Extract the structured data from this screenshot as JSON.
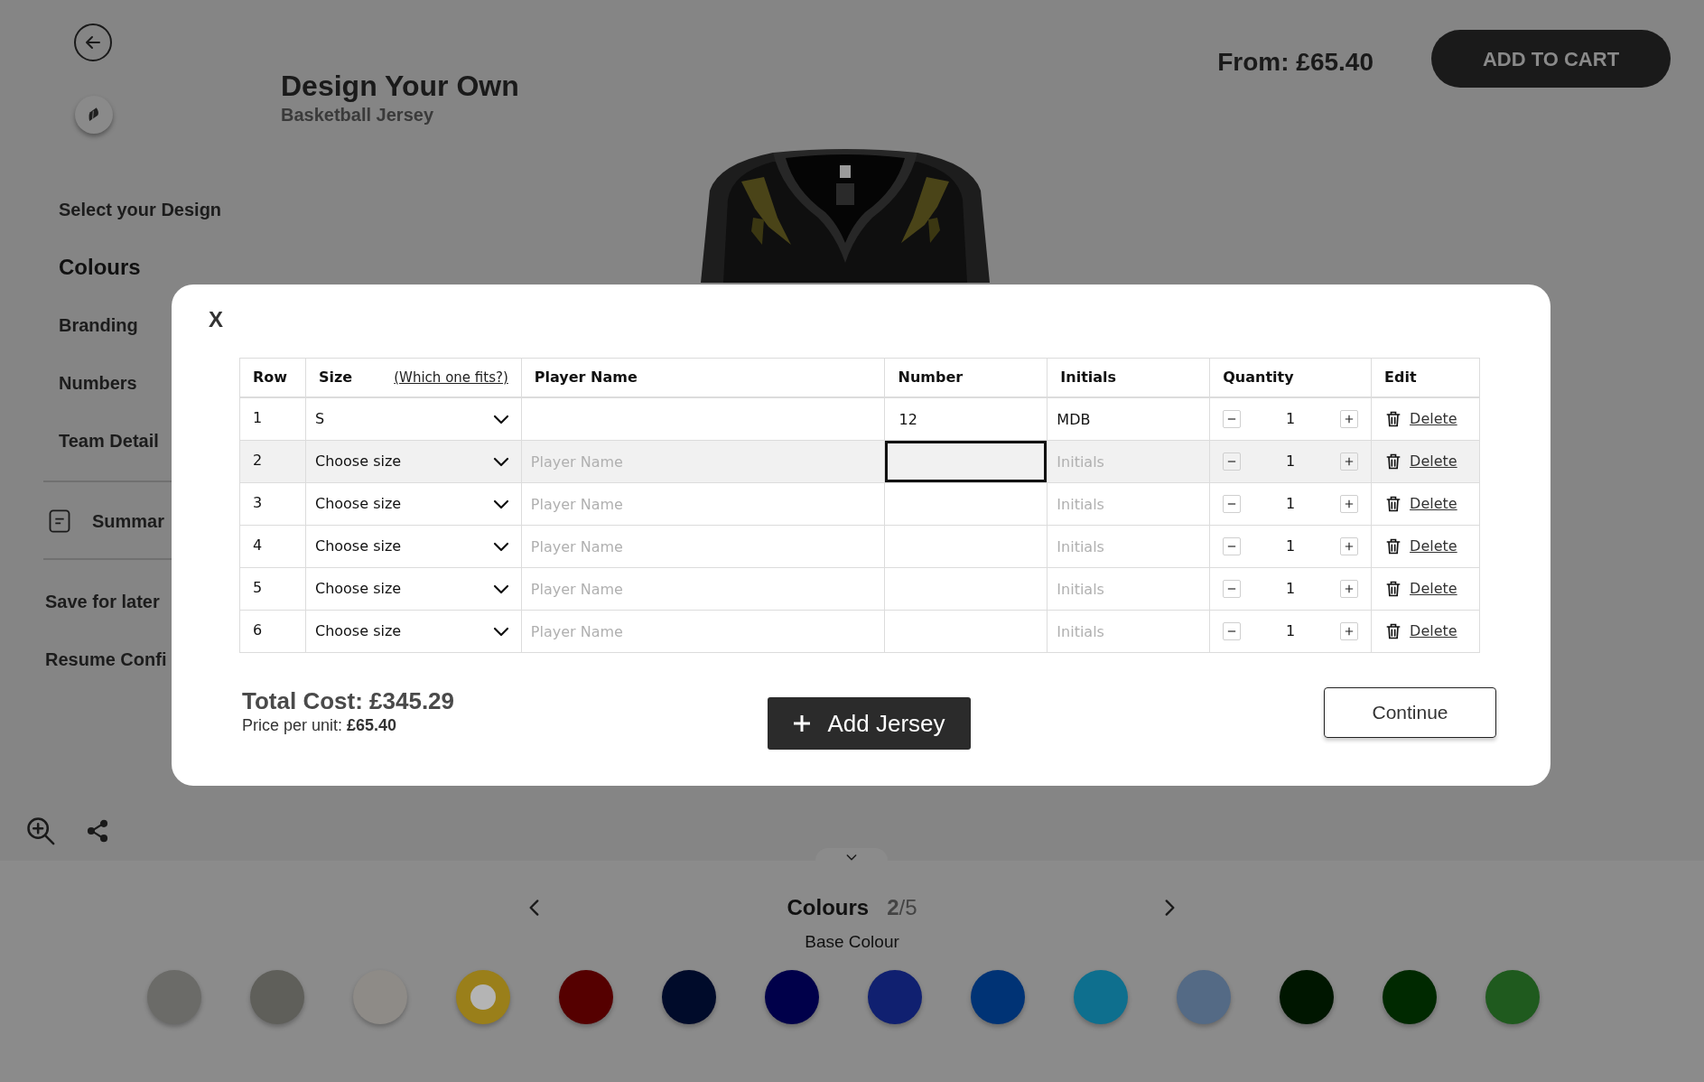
{
  "header": {
    "title": "Design Your Own",
    "subtitle": "Basketball Jersey",
    "price": "From: £65.40",
    "add_to_cart": "ADD TO CART"
  },
  "sidebar": {
    "items": [
      {
        "label": "Select your Design",
        "selected": false
      },
      {
        "label": "Colours",
        "selected": true
      },
      {
        "label": "Branding",
        "selected": false
      },
      {
        "label": "Numbers",
        "selected": false
      },
      {
        "label": "Team Detail",
        "selected": false
      }
    ],
    "summary": "Summar",
    "actions": [
      "Save for later",
      "Resume Confi"
    ]
  },
  "modal": {
    "close": "X",
    "size_help": "(Which one fits?)",
    "columns": [
      "Row",
      "Size",
      "Player Name",
      "Number",
      "Initials",
      "Quantity",
      "Edit"
    ],
    "rows": [
      {
        "row": "1",
        "size": "S",
        "player_name": {},
        "number": {
          "value": "12",
          "focused": false
        },
        "initials": {
          "value": "MDB"
        },
        "quantity": "1",
        "delete": "Delete",
        "highlighted": false
      },
      {
        "row": "2",
        "size": "Choose size",
        "player_name": {
          "placeholder": "Player Name"
        },
        "number": {
          "focused": true
        },
        "initials": {
          "placeholder": "Initials"
        },
        "quantity": "1",
        "delete": "Delete",
        "highlighted": true
      },
      {
        "row": "3",
        "size": "Choose size",
        "player_name": {
          "placeholder": "Player Name"
        },
        "number": {
          "focused": false
        },
        "initials": {
          "placeholder": "Initials"
        },
        "quantity": "1",
        "delete": "Delete",
        "highlighted": false
      },
      {
        "row": "4",
        "size": "Choose size",
        "player_name": {
          "placeholder": "Player Name"
        },
        "number": {
          "focused": false
        },
        "initials": {
          "placeholder": "Initials"
        },
        "quantity": "1",
        "delete": "Delete",
        "highlighted": false
      },
      {
        "row": "5",
        "size": "Choose size",
        "player_name": {
          "placeholder": "Player Name"
        },
        "number": {
          "focused": false
        },
        "initials": {
          "placeholder": "Initials"
        },
        "quantity": "1",
        "delete": "Delete",
        "highlighted": false
      },
      {
        "row": "6",
        "size": "Choose size",
        "player_name": {
          "placeholder": "Player Name"
        },
        "number": {
          "focused": false
        },
        "initials": {
          "placeholder": "Initials"
        },
        "quantity": "1",
        "delete": "Delete",
        "highlighted": false
      }
    ],
    "total": "Total Cost: £345.29",
    "unit_price": "Price per unit: **£65.40**",
    "add_jersey": "Add Jersey",
    "continue": "Continue"
  },
  "colour_picker": {
    "title": "Colours",
    "step": "**2**/5",
    "subtitle": "Base Colour",
    "swatches": [
      {
        "color": "#6b6b68",
        "selected": false
      },
      {
        "color": "#5f5f5a",
        "selected": false
      },
      {
        "color": "#8e8b87",
        "selected": false
      },
      {
        "color": "#9a7f1a",
        "selected": true
      },
      {
        "color": "#550000",
        "selected": false
      },
      {
        "color": "#000b2a",
        "selected": false
      },
      {
        "color": "#00004a",
        "selected": false
      },
      {
        "color": "#102070",
        "selected": false
      },
      {
        "color": "#003375",
        "selected": false
      },
      {
        "color": "#0e6f8e",
        "selected": false
      },
      {
        "color": "#546a85",
        "selected": false
      },
      {
        "color": "#001600",
        "selected": false
      },
      {
        "color": "#002900",
        "selected": false
      },
      {
        "color": "#1f5a1e",
        "selected": false
      }
    ]
  }
}
